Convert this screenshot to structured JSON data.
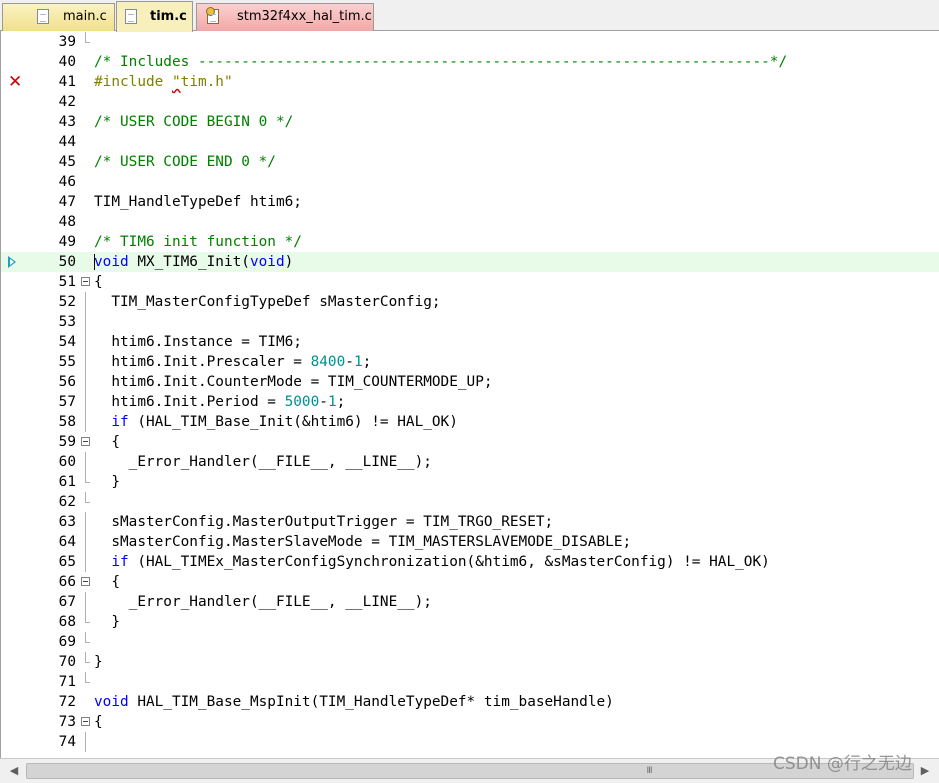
{
  "tabs": [
    {
      "label": "main.c",
      "icon": "c-file-icon",
      "active": false
    },
    {
      "label": "tim.c",
      "icon": "c-file-icon",
      "active": true
    },
    {
      "label": "stm32f4xx_hal_tim.c",
      "icon": "library-file-icon",
      "active": false
    }
  ],
  "editor": {
    "current_line": 50,
    "error_line": 41,
    "lines": [
      {
        "num": "39",
        "segments": [],
        "fold": "end"
      },
      {
        "num": "40",
        "segments": [
          [
            "c",
            "/* Includes ------------------------------------------------------------------*/"
          ]
        ]
      },
      {
        "num": "41",
        "segments": [
          [
            "p",
            "#include "
          ],
          [
            "ps",
            "\""
          ],
          [
            "p",
            "tim.h\""
          ]
        ],
        "marker": "error"
      },
      {
        "num": "42",
        "segments": []
      },
      {
        "num": "43",
        "segments": [
          [
            "c",
            "/* USER CODE BEGIN 0 */"
          ]
        ]
      },
      {
        "num": "44",
        "segments": []
      },
      {
        "num": "45",
        "segments": [
          [
            "c",
            "/* USER CODE END 0 */"
          ]
        ]
      },
      {
        "num": "46",
        "segments": []
      },
      {
        "num": "47",
        "segments": [
          [
            "",
            "TIM_HandleTypeDef htim6;"
          ]
        ]
      },
      {
        "num": "48",
        "segments": []
      },
      {
        "num": "49",
        "segments": [
          [
            "c",
            "/* TIM6 init function */"
          ]
        ]
      },
      {
        "num": "50",
        "segments": [
          [
            "k",
            "void"
          ],
          [
            "",
            " MX_TIM6_Init("
          ],
          [
            "k",
            "void"
          ],
          [
            "",
            ")"
          ]
        ],
        "marker": "current"
      },
      {
        "num": "51",
        "segments": [
          [
            "",
            "{"
          ]
        ],
        "fold": "open"
      },
      {
        "num": "52",
        "segments": [
          [
            "",
            "  TIM_MasterConfigTypeDef sMasterConfig;"
          ]
        ],
        "fold": "line"
      },
      {
        "num": "53",
        "segments": [],
        "fold": "line"
      },
      {
        "num": "54",
        "segments": [
          [
            "",
            "  htim6.Instance = TIM6;"
          ]
        ],
        "fold": "line"
      },
      {
        "num": "55",
        "segments": [
          [
            "",
            "  htim6.Init.Prescaler = "
          ],
          [
            "n",
            "8400"
          ],
          [
            "",
            "-"
          ],
          [
            "n",
            "1"
          ],
          [
            "",
            ";"
          ]
        ],
        "fold": "line"
      },
      {
        "num": "56",
        "segments": [
          [
            "",
            "  htim6.Init.CounterMode = TIM_COUNTERMODE_UP;"
          ]
        ],
        "fold": "line"
      },
      {
        "num": "57",
        "segments": [
          [
            "",
            "  htim6.Init.Period = "
          ],
          [
            "n",
            "5000"
          ],
          [
            "",
            "-"
          ],
          [
            "n",
            "1"
          ],
          [
            "",
            ";"
          ]
        ],
        "fold": "line"
      },
      {
        "num": "58",
        "segments": [
          [
            "",
            "  "
          ],
          [
            "k",
            "if"
          ],
          [
            "",
            " (HAL_TIM_Base_Init(&htim6) != HAL_OK)"
          ]
        ],
        "fold": "line"
      },
      {
        "num": "59",
        "segments": [
          [
            "",
            "  {"
          ]
        ],
        "fold": "open"
      },
      {
        "num": "60",
        "segments": [
          [
            "",
            "    _Error_Handler(__FILE__, __LINE__);"
          ]
        ],
        "fold": "line"
      },
      {
        "num": "61",
        "segments": [
          [
            "",
            "  }"
          ]
        ],
        "fold": "end"
      },
      {
        "num": "62",
        "segments": [],
        "fold": "end"
      },
      {
        "num": "63",
        "segments": [
          [
            "",
            "  sMasterConfig.MasterOutputTrigger = TIM_TRGO_RESET;"
          ]
        ],
        "fold": "line"
      },
      {
        "num": "64",
        "segments": [
          [
            "",
            "  sMasterConfig.MasterSlaveMode = TIM_MASTERSLAVEMODE_DISABLE;"
          ]
        ],
        "fold": "line"
      },
      {
        "num": "65",
        "segments": [
          [
            "",
            "  "
          ],
          [
            "k",
            "if"
          ],
          [
            "",
            " (HAL_TIMEx_MasterConfigSynchronization(&htim6, &sMasterConfig) != HAL_OK)"
          ]
        ],
        "fold": "line"
      },
      {
        "num": "66",
        "segments": [
          [
            "",
            "  {"
          ]
        ],
        "fold": "open"
      },
      {
        "num": "67",
        "segments": [
          [
            "",
            "    _Error_Handler(__FILE__, __LINE__);"
          ]
        ],
        "fold": "line"
      },
      {
        "num": "68",
        "segments": [
          [
            "",
            "  }"
          ]
        ],
        "fold": "end"
      },
      {
        "num": "69",
        "segments": [],
        "fold": "end"
      },
      {
        "num": "70",
        "segments": [
          [
            "",
            "}"
          ]
        ],
        "fold": "end"
      },
      {
        "num": "71",
        "segments": [],
        "fold": "end"
      },
      {
        "num": "72",
        "segments": [
          [
            "k",
            "void"
          ],
          [
            "",
            " HAL_TIM_Base_MspInit(TIM_HandleTypeDef* tim_baseHandle)"
          ]
        ]
      },
      {
        "num": "73",
        "segments": [
          [
            "",
            "{"
          ]
        ],
        "fold": "open"
      },
      {
        "num": "74",
        "segments": [],
        "fold": "line"
      }
    ]
  },
  "scrollbar": {
    "grip": "III"
  },
  "watermark": "CSDN @行之无边",
  "colors": {
    "comment": "#008000",
    "keyword": "#0000ff",
    "number": "#009090",
    "preprocessor": "#808000",
    "current_line_bg": "#e8fbe8",
    "error_marker": "#cc0000",
    "exec_marker": "#1aa0c8"
  }
}
